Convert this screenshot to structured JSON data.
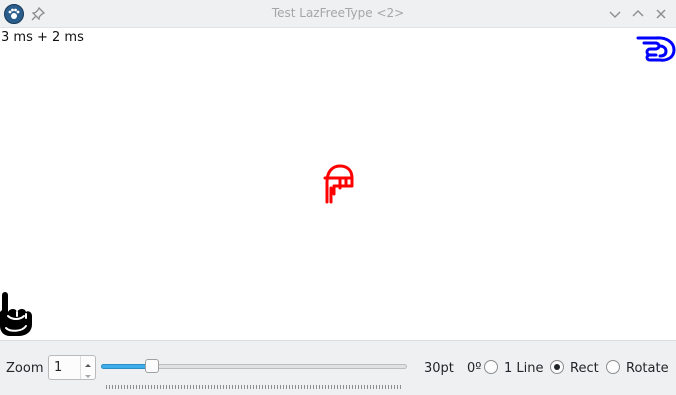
{
  "window": {
    "title": "Test LazFreeType <2>",
    "app_icon": "paw-icon",
    "pin_icon": "pin-icon",
    "buttons": [
      "minimize-chevron-icon",
      "maximize-chevron-icon",
      "close-x-icon"
    ]
  },
  "canvas": {
    "timing_text": "3 ms + 2 ms",
    "glyphs": [
      {
        "name": "pointing-hand-left-glyph",
        "color": "#0000ff"
      },
      {
        "name": "pointing-hand-down-glyph",
        "color": "#ff0000"
      },
      {
        "name": "pointing-hand-up-glyph",
        "color": "#000000"
      }
    ]
  },
  "toolbar": {
    "zoom_label": "Zoom",
    "zoom_value": "1",
    "slider_fraction": 0.11,
    "size_label": "30pt",
    "angle_label": "0º",
    "options": [
      {
        "label": "1 Line",
        "selected": false
      },
      {
        "label": "Rect",
        "selected": true
      },
      {
        "label": "Rotate",
        "selected": false
      }
    ]
  },
  "colors": {
    "accent": "#3daee9",
    "window_bg": "#eff0f1"
  }
}
